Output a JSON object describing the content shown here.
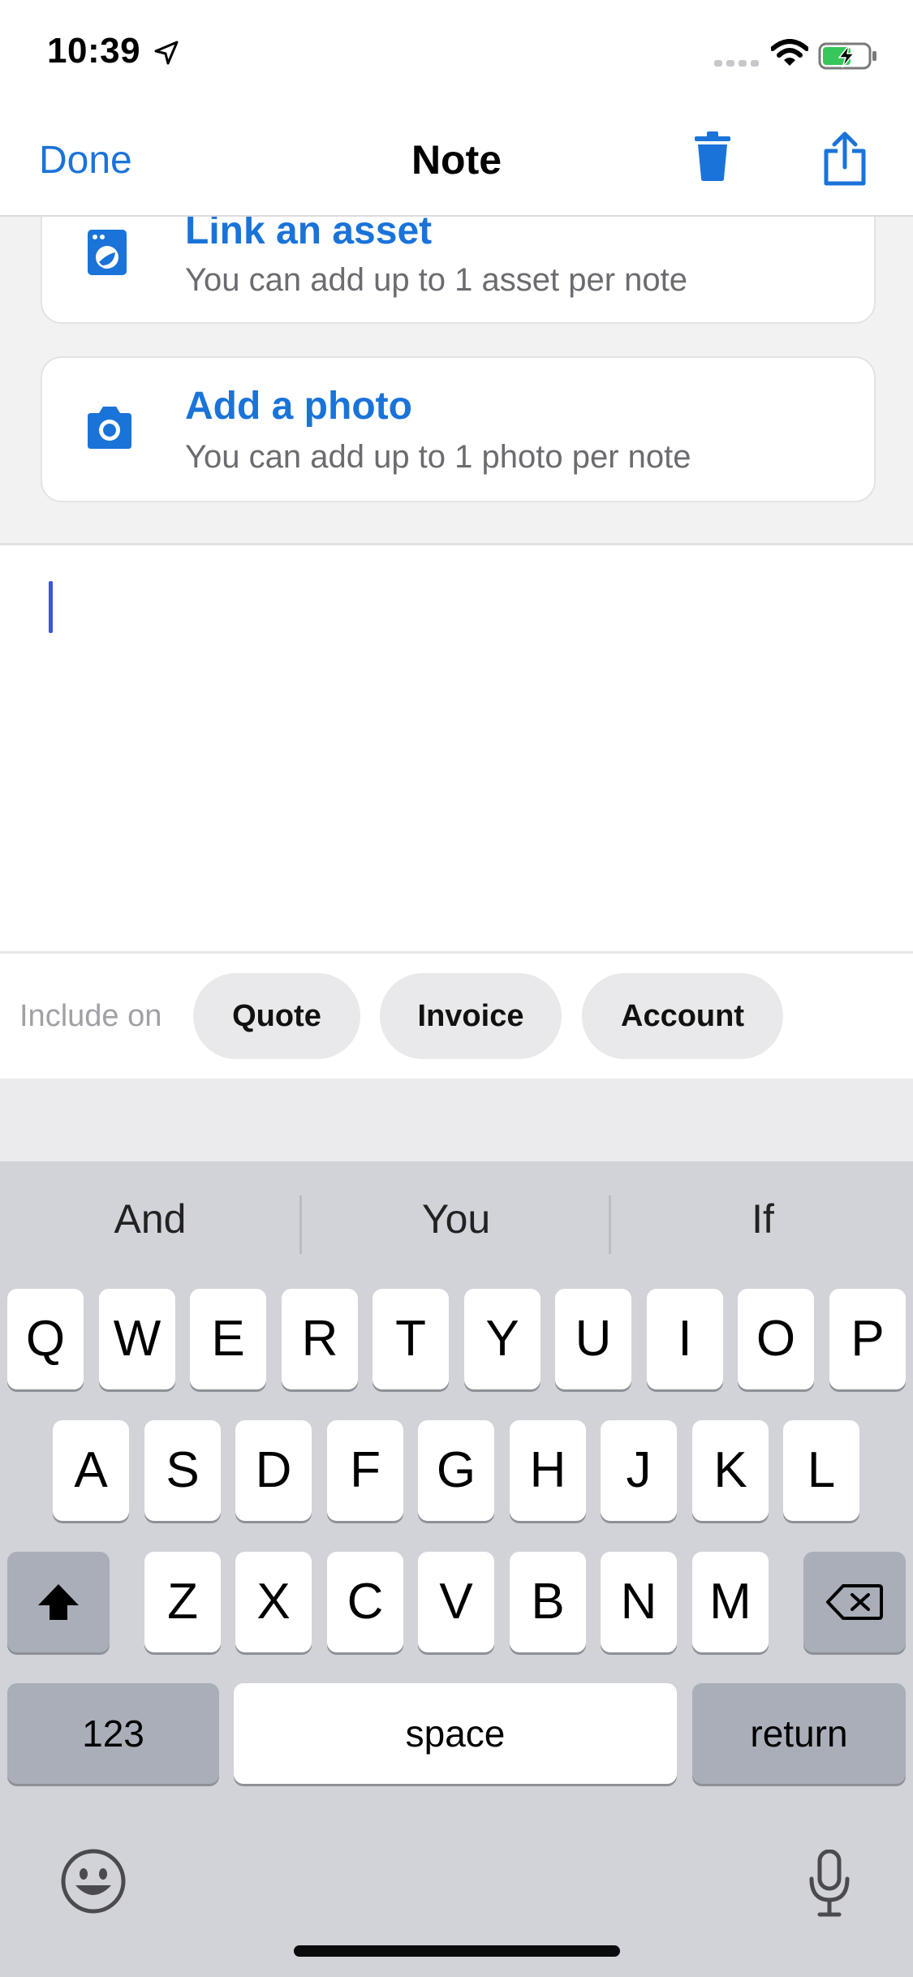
{
  "status_bar": {
    "time": "10:39"
  },
  "nav": {
    "done": "Done",
    "title": "Note"
  },
  "attachments": [
    {
      "title": "Link an asset",
      "subtitle": "You can add up to 1 asset per note",
      "icon": "washer-icon"
    },
    {
      "title": "Add a photo",
      "subtitle": "You can add up to 1 photo per note",
      "icon": "camera-icon"
    }
  ],
  "include_on": {
    "label": "Include on",
    "options": [
      "Quote",
      "Invoice",
      "Account"
    ]
  },
  "keyboard": {
    "suggestions": [
      "And",
      "You",
      "If"
    ],
    "rows": [
      [
        "Q",
        "W",
        "E",
        "R",
        "T",
        "Y",
        "U",
        "I",
        "O",
        "P"
      ],
      [
        "A",
        "S",
        "D",
        "F",
        "G",
        "H",
        "J",
        "K",
        "L"
      ],
      [
        "Z",
        "X",
        "C",
        "V",
        "B",
        "N",
        "M"
      ]
    ],
    "numbers_key": "123",
    "space_key": "space",
    "return_key": "return"
  },
  "colors": {
    "accent": "#1a73d9",
    "cursor": "#3c56d8",
    "keyboard_bg": "#d1d3d9"
  }
}
